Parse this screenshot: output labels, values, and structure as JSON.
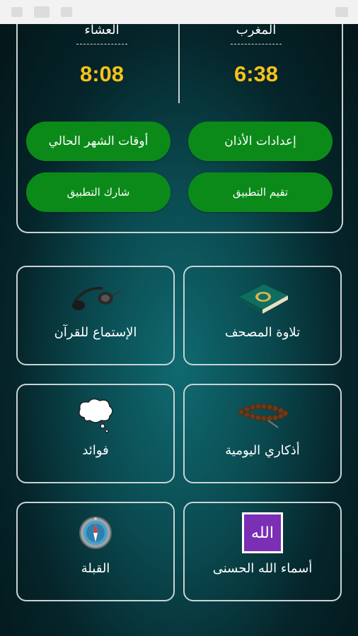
{
  "prayers": [
    {
      "name": "المغرب",
      "time": "6:38"
    },
    {
      "name": "العشاء",
      "time": "8:08"
    }
  ],
  "buttons": {
    "adhan_settings": "إعدادات الأذان",
    "month_times": "أوقات الشهر الحالي",
    "rate_app": "تقيم التطبيق",
    "share_app": "شارك التطبيق"
  },
  "tiles": {
    "read_mushaf": "تلاوة المصحف",
    "listen_quran": "الإستماع للقرآن",
    "daily_adhkar": "أذكاري اليومية",
    "benefits": "فوائد",
    "names_of_allah": "أسماء الله الحسنى",
    "qibla": "القبلة"
  },
  "logo_text": "الله",
  "colors": {
    "accent_green": "#0b8a1a",
    "time_yellow": "#f7c21b",
    "border": "#c9d2d4"
  },
  "icons": [
    "quran-book-icon",
    "headphones-icon",
    "prayer-beads-icon",
    "thought-cloud-icon",
    "allah-calligraphy-icon",
    "compass-icon"
  ]
}
